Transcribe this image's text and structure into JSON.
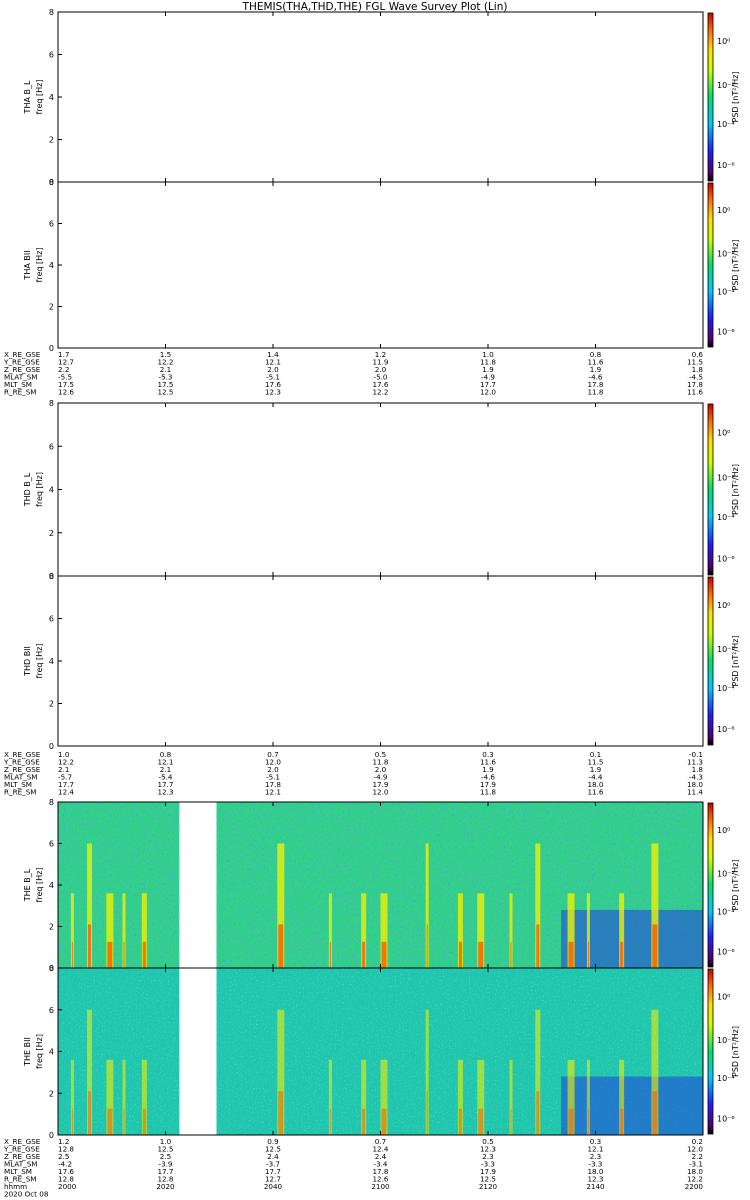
{
  "title": "THEMIS(THA,THD,THE) FGL Wave Survey Plot (Lin)",
  "colorbar": {
    "label": "PSD [nT²/Hz]",
    "tick_labels": [
      "10⁰",
      "10⁻²",
      "10⁻⁴",
      "10⁻⁶"
    ]
  },
  "panels": [
    {
      "probe": "THA",
      "component": "B_L",
      "ylabel": "THA B_L",
      "yunit": "freq [Hz]"
    },
    {
      "probe": "THA",
      "component": "B_II",
      "ylabel": "THA BII",
      "yunit": "freq [Hz]"
    },
    {
      "probe": "THD",
      "component": "B_L",
      "ylabel": "THD B_L",
      "yunit": "freq [Hz]"
    },
    {
      "probe": "THD",
      "component": "B_II",
      "ylabel": "THD BII",
      "yunit": "freq [Hz]"
    },
    {
      "probe": "THE",
      "component": "B_L",
      "ylabel": "THE B_L",
      "yunit": "freq [Hz]"
    },
    {
      "probe": "THE",
      "component": "B_II",
      "ylabel": "THE BII",
      "yunit": "freq [Hz]"
    }
  ],
  "orbit_blocks": [
    {
      "probe": "THA",
      "labels": [
        "X_RE_GSE",
        "Y_RE_GSE",
        "Z_RE_GSE",
        "MLAT_SM",
        "MLT_SM",
        "R_RE_SM"
      ],
      "rows": [
        [
          "1.7",
          "1.5",
          "1.4",
          "1.2",
          "1.0",
          "0.8",
          "0.6"
        ],
        [
          "12.7",
          "12.2",
          "12.1",
          "11.9",
          "11.8",
          "11.6",
          "11.5"
        ],
        [
          "2.2",
          "2.1",
          "2.0",
          "2.0",
          "1.9",
          "1.9",
          "1.8"
        ],
        [
          "-5.5",
          "-5.3",
          "-5.1",
          "-5.0",
          "-4.9",
          "-4.6",
          "-4.5"
        ],
        [
          "17.5",
          "17.5",
          "17.6",
          "17.6",
          "17.7",
          "17.8",
          "17.8"
        ],
        [
          "12.6",
          "12.5",
          "12.3",
          "12.2",
          "12.0",
          "11.8",
          "11.6"
        ]
      ]
    },
    {
      "probe": "THD",
      "labels": [
        "X_RE_GSE",
        "Y_RE_GSE",
        "Z_RE_GSE",
        "MLAT_SM",
        "MLT_SM",
        "R_RE_SM"
      ],
      "rows": [
        [
          "1.0",
          "0.8",
          "0.7",
          "0.5",
          "0.3",
          "0.1",
          "-0.1"
        ],
        [
          "12.2",
          "12.1",
          "12.0",
          "11.8",
          "11.6",
          "11.5",
          "11.3"
        ],
        [
          "2.1",
          "2.1",
          "2.0",
          "2.0",
          "1.9",
          "1.9",
          "1.8"
        ],
        [
          "-5.7",
          "-5.4",
          "-5.1",
          "-4.9",
          "-4.6",
          "-4.4",
          "-4.3"
        ],
        [
          "17.7",
          "17.7",
          "17.8",
          "17.9",
          "17.9",
          "18.0",
          "18.0"
        ],
        [
          "12.4",
          "12.3",
          "12.1",
          "12.0",
          "11.8",
          "11.6",
          "11.4"
        ]
      ]
    },
    {
      "probe": "THE",
      "labels": [
        "X_RE_GSE",
        "Y_RE_GSE",
        "Z_RE_GSE",
        "MLAT_SM",
        "MLT_SM",
        "R_RE_SM",
        "hhmm",
        "2020 Oct 08"
      ],
      "rows": [
        [
          "1.2",
          "1.0",
          "0.9",
          "0.7",
          "0.5",
          "0.3",
          "0.2"
        ],
        [
          "12.8",
          "12.5",
          "12.5",
          "12.4",
          "12.3",
          "12.1",
          "12.0"
        ],
        [
          "2.5",
          "2.5",
          "2.4",
          "2.4",
          "2.3",
          "2.3",
          "2.2"
        ],
        [
          "-4.2",
          "-3.9",
          "-3.7",
          "-3.4",
          "-3.3",
          "-3.3",
          "-3.1"
        ],
        [
          "17.6",
          "17.7",
          "17.7",
          "17.8",
          "17.9",
          "18.0",
          "18.0"
        ],
        [
          "12.8",
          "12.8",
          "12.7",
          "12.6",
          "12.5",
          "12.3",
          "12.2"
        ],
        [
          "2000",
          "2020",
          "2040",
          "2100",
          "2120",
          "2140",
          "2200"
        ]
      ]
    }
  ],
  "chart_data": {
    "type": "heatmap",
    "title": "THEMIS(THA,THD,THE) FGL Wave Survey Plot (Lin)",
    "xlabel": "hhmm",
    "date": "2020 Oct 08",
    "x_ticks": [
      "2000",
      "2020",
      "2040",
      "2100",
      "2120",
      "2140",
      "2200"
    ],
    "ylabel": "freq [Hz]",
    "ylim": [
      0,
      8
    ],
    "y_ticks": [
      0,
      2,
      4,
      6,
      8
    ],
    "colorbar": {
      "label": "PSD [nT²/Hz]",
      "scale": "log",
      "ticks": [
        "10⁰",
        "10⁻²",
        "10⁻⁴",
        "10⁻⁶"
      ]
    },
    "panels_with_data": [
      "THE B_L",
      "THE BII"
    ],
    "panels_empty": [
      "THA B_L",
      "THA BII",
      "THD B_L",
      "THD BII"
    ],
    "data_gap": [
      "2025",
      "2028"
    ]
  }
}
